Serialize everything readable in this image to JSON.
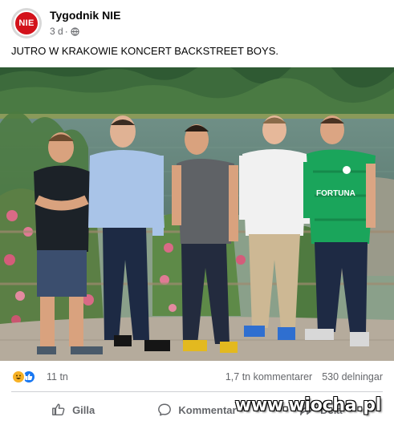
{
  "post": {
    "page_name": "Tygodnik NIE",
    "avatar_text": "NIE",
    "time": "3 d",
    "separator": "·",
    "audience_icon": "globe-icon",
    "text": "JUTRO W KRAKOWIE KONCERT BACKSTREET BOYS."
  },
  "photo": {
    "jersey_text": "FORTUNA",
    "scene": [
      "forest",
      "lake",
      "five-men-standing",
      "flowers",
      "gravel-path"
    ]
  },
  "reactions": {
    "icons": [
      "haha-icon",
      "like-icon"
    ],
    "count": "11 tn",
    "comments": "1,7 tn kommentarer",
    "shares": "530 delningar"
  },
  "actions": {
    "like_label": "Gilla",
    "comment_label": "Kommentar",
    "share_label": "Dela"
  },
  "watermark": "www.wiocha.pl",
  "colors": {
    "avatar_red": "#d3121b",
    "like_blue": "#1877f2",
    "haha_yellow": "#f7b125",
    "meta_gray": "#65676b",
    "jersey_green": "#1aa55b"
  }
}
